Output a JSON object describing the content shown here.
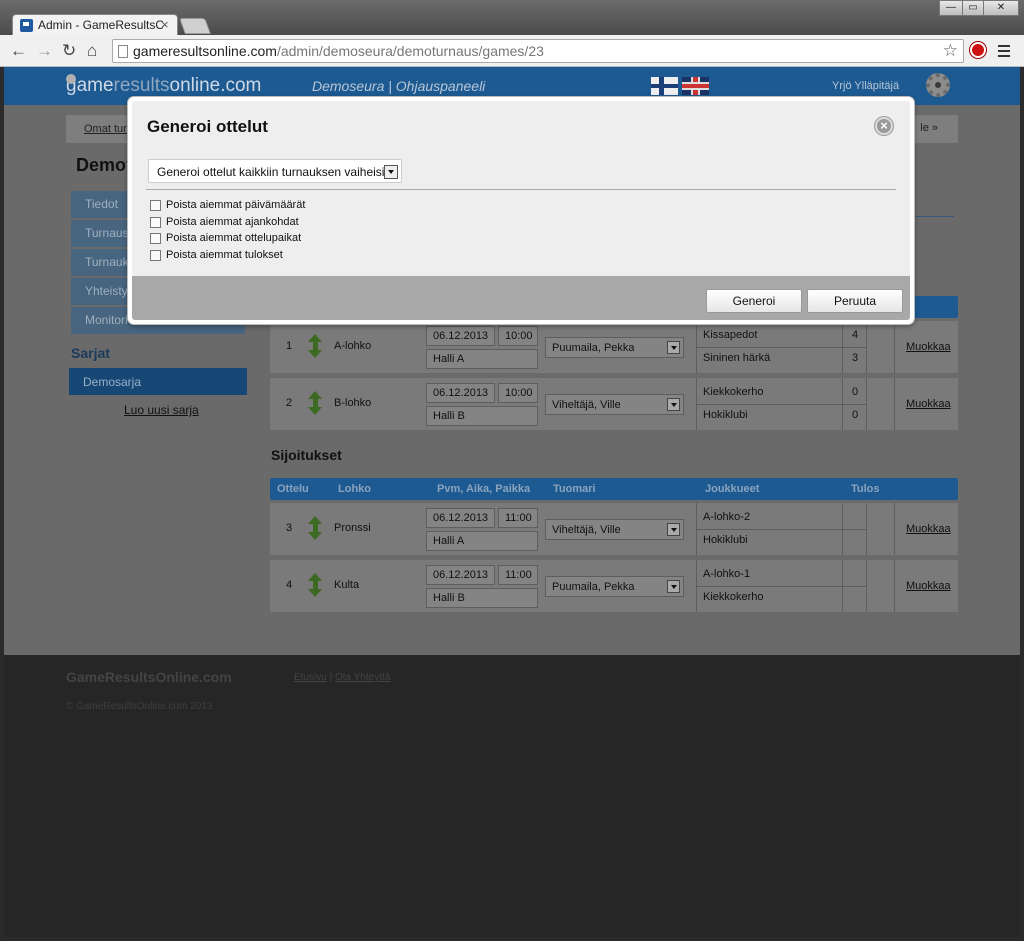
{
  "browser": {
    "tab_title": "Admin - GameResultsOnli",
    "tab_close": "×",
    "url_host": "gameresultsonline.com",
    "url_path": "/admin/demoseura/demoturnaus/games/23",
    "window_controls": [
      "—",
      "▭",
      "✕"
    ]
  },
  "header": {
    "logo_a": "game",
    "logo_b": "results",
    "logo_c": "online.com",
    "club": "Demoseura | Ohjauspaneeli",
    "user": "Yrjö Ylläpitäjä"
  },
  "breadcrumb": {
    "first": "Omat turn",
    "last": "le  »"
  },
  "page_title": "Demot",
  "sidebar": {
    "items": [
      {
        "label": "Tiedot"
      },
      {
        "label": "Turnaus"
      },
      {
        "label": "Turnauk"
      },
      {
        "label": "Yhteisty"
      },
      {
        "label": "Monitori"
      }
    ],
    "section_title": "Sarjat",
    "selected": "Demosarja",
    "new_link": "Luo uusi sarja"
  },
  "group_games": [
    {
      "num": "1",
      "group": "A-lohko",
      "date": "06.12.2013",
      "time": "10:00",
      "place": "Halli A",
      "referee": "Puumaila, Pekka",
      "team1": "Kissapedot",
      "team2": "Sininen härkä",
      "score1": "4",
      "score2": "3",
      "edit": "Muokkaa"
    },
    {
      "num": "2",
      "group": "B-lohko",
      "date": "06.12.2013",
      "time": "10:00",
      "place": "Halli B",
      "referee": "Viheltäjä, Ville",
      "team1": "Kiekkokerho",
      "team2": "Hokiklubi",
      "score1": "0",
      "score2": "0",
      "edit": "Muokkaa"
    }
  ],
  "placements": {
    "title": "Sijoitukset",
    "columns": [
      "Ottelu",
      "Lohko",
      "Pvm, Aika, Paikka",
      "Tuomari",
      "Joukkueet",
      "Tulos"
    ],
    "games": [
      {
        "num": "3",
        "group": "Pronssi",
        "date": "06.12.2013",
        "time": "11:00",
        "place": "Halli A",
        "referee": "Viheltäjä, Ville",
        "team1": "A-lohko-2",
        "team2": "Hokiklubi",
        "score1": "",
        "score2": "",
        "edit": "Muokkaa"
      },
      {
        "num": "4",
        "group": "Kulta",
        "date": "06.12.2013",
        "time": "11:00",
        "place": "Halli B",
        "referee": "Puumaila, Pekka",
        "team1": "A-lohko-1",
        "team2": "Kiekkokerho",
        "score1": "",
        "score2": "",
        "edit": "Muokkaa"
      }
    ]
  },
  "footer": {
    "brand": "GameResultsOnline.com",
    "link_home": "Etusivu",
    "separator": " | ",
    "link_contact": "Ota Yhteyttä",
    "copyright": "© GameResultsOnline.com 2013"
  },
  "modal": {
    "title": "Generoi ottelut",
    "close": "×",
    "select_value": "Generoi ottelut kaikkiin turnauksen vaiheisiin",
    "checkboxes": [
      {
        "label": "Poista aiemmat päivämäärät"
      },
      {
        "label": "Poista aiemmat ajankohdat"
      },
      {
        "label": "Poista aiemmat ottelupaikat"
      },
      {
        "label": "Poista aiemmat tulokset"
      }
    ],
    "generate_button": "Generoi",
    "cancel_button": "Peruuta"
  },
  "colors": {
    "brand_blue": "#1d5a92",
    "overlay_dim": "#6a6a6a"
  },
  "icons": [
    "back-arrow-icon",
    "forward-arrow-icon",
    "reload-icon",
    "home-icon",
    "star-icon",
    "menu-icon",
    "gear-icon",
    "finnish-flag-icon",
    "uk-flag-icon",
    "close-icon",
    "reorder-arrows-icon",
    "dropdown-arrow-icon"
  ]
}
